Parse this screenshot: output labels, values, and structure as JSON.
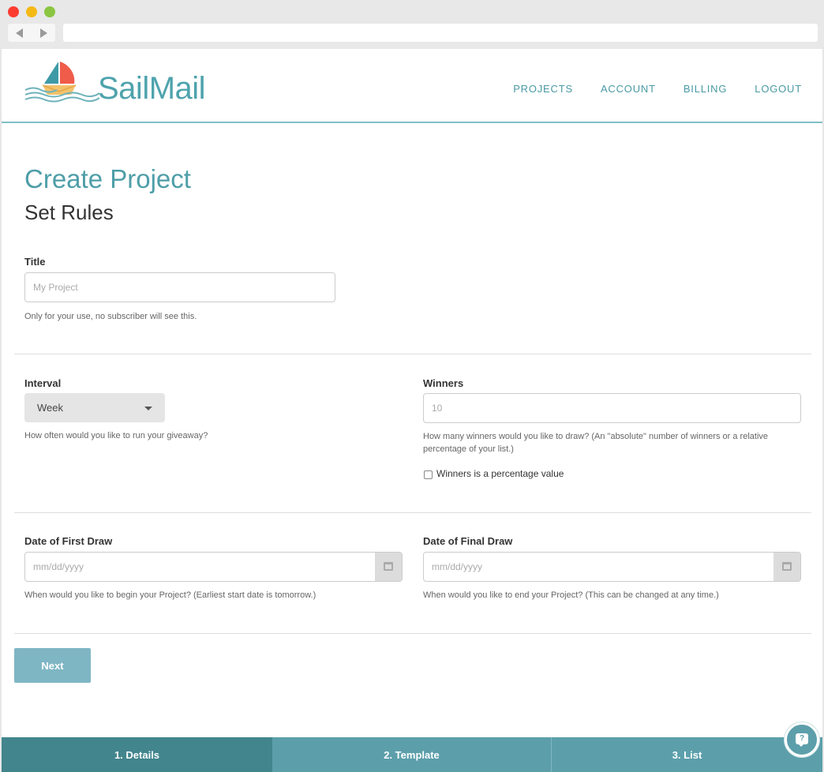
{
  "brand": {
    "name": "SailMail",
    "accent": "#4ea3ad"
  },
  "nav": {
    "items": [
      "PROJECTS",
      "ACCOUNT",
      "BILLING",
      "LOGOUT"
    ]
  },
  "page": {
    "title": "Create Project",
    "subtitle": "Set Rules"
  },
  "form": {
    "title": {
      "label": "Title",
      "placeholder": "My Project",
      "help": "Only for your use, no subscriber will see this."
    },
    "interval": {
      "label": "Interval",
      "value": "Week",
      "help": "How often would you like to run your giveaway?"
    },
    "winners": {
      "label": "Winners",
      "placeholder": "10",
      "help": "How many winners would you like to draw? (An \"absolute\" number of winners or a relative percentage of your list.)",
      "checkbox_label": "Winners is a percentage value",
      "checkbox_checked": false
    },
    "first_draw": {
      "label": "Date of First Draw",
      "placeholder": "mm/dd/yyyy",
      "help": "When would you like to begin your Project? (Earliest start date is tomorrow.)"
    },
    "final_draw": {
      "label": "Date of Final Draw",
      "placeholder": "mm/dd/yyyy",
      "help": "When would you like to end your Project? (This can be changed at any time.)"
    },
    "next_label": "Next"
  },
  "steps": [
    "1. Details",
    "2. Template",
    "3. List"
  ],
  "help_fab": {
    "icon": "question-bubble-icon",
    "glyph": "?"
  }
}
